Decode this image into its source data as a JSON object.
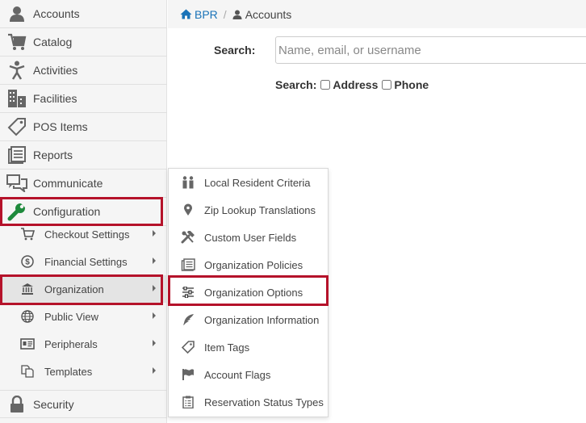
{
  "breadcrumb": {
    "home": "BPR",
    "separator": "/",
    "current": "Accounts"
  },
  "search": {
    "label": "Search:",
    "placeholder": "Name, email, or username",
    "options_label": "Search:",
    "address_label": "Address",
    "phone_label": "Phone"
  },
  "sidebar": {
    "items": [
      {
        "label": "Accounts"
      },
      {
        "label": "Catalog"
      },
      {
        "label": "Activities"
      },
      {
        "label": "Facilities"
      },
      {
        "label": "POS Items"
      },
      {
        "label": "Reports"
      },
      {
        "label": "Communicate"
      },
      {
        "label": "Configuration"
      }
    ],
    "sub_items": [
      {
        "label": "Checkout Settings"
      },
      {
        "label": "Financial Settings"
      },
      {
        "label": "Organization"
      },
      {
        "label": "Public View"
      },
      {
        "label": "Peripherals"
      },
      {
        "label": "Templates"
      }
    ],
    "bottom_item": {
      "label": "Security"
    }
  },
  "flyout": {
    "items": [
      {
        "label": "Local Resident Criteria"
      },
      {
        "label": "Zip Lookup Translations"
      },
      {
        "label": "Custom User Fields"
      },
      {
        "label": "Organization Policies"
      },
      {
        "label": "Organization Options"
      },
      {
        "label": "Organization Information"
      },
      {
        "label": "Item Tags"
      },
      {
        "label": "Account Flags"
      },
      {
        "label": "Reservation Status Types"
      }
    ]
  },
  "colors": {
    "highlight": "#b5122a",
    "link": "#1a73b8",
    "config_icon": "#1e8a3c"
  }
}
